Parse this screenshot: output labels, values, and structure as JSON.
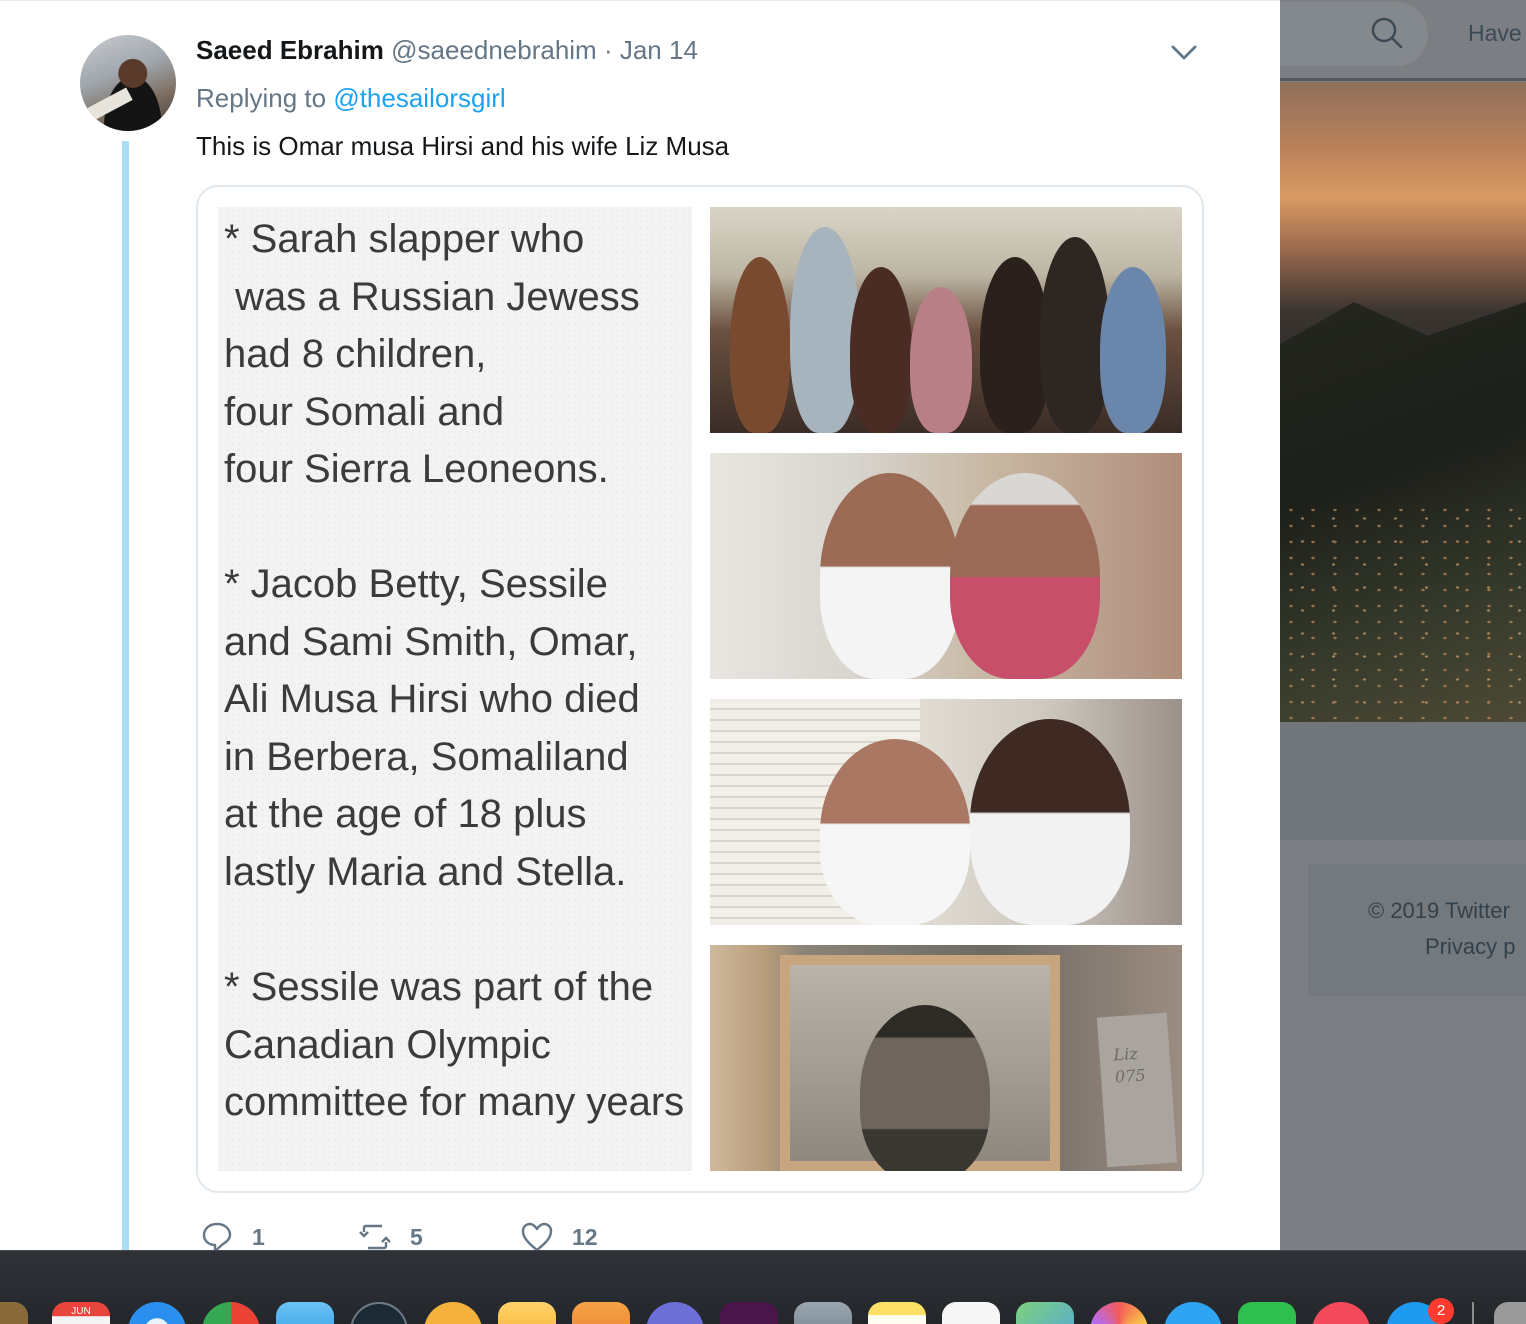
{
  "tweet": {
    "display_name": "Saeed Ebrahim",
    "handle": "@saeednebrahim",
    "separator": " · ",
    "date": "Jan 14",
    "replying_prefix": "Replying to ",
    "replying_to": "@thesailorsgirl",
    "text": "This is Omar musa Hirsi and his wife Liz Musa",
    "image_text": [
      "* Sarah slapper who\n was a Russian Jewess\nhad 8 children,\nfour Somali and\nfour Sierra Leoneons.",
      "* Jacob Betty, Sessile\nand Sami Smith, Omar,\nAli Musa Hirsi who died\nin Berbera, Somaliland\nat the age of 18 plus\nlastly Maria and Stella.",
      "* Sessile was part of the\nCanadian Olympic\ncommittee for many years"
    ],
    "photo_note": "Liz\n075",
    "actions": {
      "replies": "1",
      "retweets": "5",
      "likes": "12"
    }
  },
  "background_page": {
    "search_icon": "search-icon",
    "have_button": "Have",
    "footer_copyright": "© 2019 Twitter",
    "footer_link": "Privacy p"
  },
  "dock": {
    "calendar_month": "JUN",
    "badge_count": "2"
  },
  "colors": {
    "link_blue": "#1da1f2",
    "thread_line": "#a9def5",
    "muted_text": "#657786",
    "primary_text": "#14171a"
  }
}
